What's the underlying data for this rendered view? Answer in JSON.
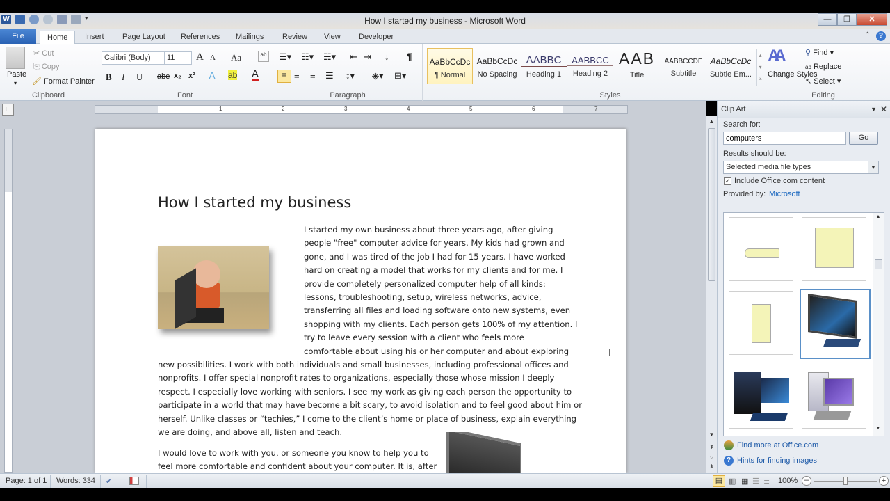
{
  "window": {
    "title": "How I started my business - Microsoft Word",
    "minimize_icon": "minimize-icon",
    "restore_icon": "restore-icon",
    "close_icon": "close-icon"
  },
  "qat": [
    "word-logo-icon",
    "save-icon",
    "undo-icon",
    "redo-icon",
    "print-preview-icon",
    "print-icon",
    "customize-qat-icon"
  ],
  "tabs": [
    "File",
    "Home",
    "Insert",
    "Page Layout",
    "References",
    "Mailings",
    "Review",
    "View",
    "Developer"
  ],
  "ribbon": {
    "clipboard": {
      "label": "Clipboard",
      "paste": "Paste",
      "cut": "Cut",
      "copy": "Copy",
      "format_painter": "Format Painter"
    },
    "font": {
      "label": "Font",
      "font_name": "Calibri (Body)",
      "font_size": "11",
      "grow": "A",
      "shrink": "A",
      "change_case": "Aa",
      "bold": "B",
      "italic": "I",
      "underline": "U",
      "strike": "abe",
      "subscript": "x₂",
      "superscript": "x²"
    },
    "paragraph": {
      "label": "Paragraph",
      "pilcrow": "¶"
    },
    "styles": {
      "label": "Styles",
      "items": [
        {
          "preview": "AaBbCcDc",
          "name": "¶ Normal"
        },
        {
          "preview": "AaBbCcDc",
          "name": "No Spacing"
        },
        {
          "preview": "AABBC",
          "name": "Heading 1"
        },
        {
          "preview": "AABBCC",
          "name": "Heading 2"
        },
        {
          "preview": "AAB",
          "name": "Title"
        },
        {
          "preview": "AABBCCDE",
          "name": "Subtitle"
        },
        {
          "preview": "AaBbCcDc",
          "name": "Subtle Em..."
        }
      ],
      "change_styles": "Change Styles"
    },
    "editing": {
      "label": "Editing",
      "find": "Find",
      "replace": "Replace",
      "select": "Select"
    }
  },
  "ruler": {
    "numbers": [
      "1",
      "2",
      "3",
      "4",
      "5",
      "6",
      "7"
    ]
  },
  "document": {
    "title": "How I started my business",
    "wrapped_lines": [
      "I started my own business about three years ago, after giving",
      "people \"free\" computer advice for years. My kids had grown and",
      "gone, and I was tired of the job I had for 15 years. I have worked",
      "hard on creating a model that works for my clients and for me. I",
      "provide completely personalized computer help of all kinds:",
      "lessons, troubleshooting, setup, wireless networks, advice,",
      "transferring all files and loading software onto new systems, even",
      "shopping with my clients. Each person gets 100% of my attention. I",
      "try to leave every session with a client who feels more",
      "comfortable about using his or her computer and about exploring"
    ],
    "full_lines": [
      "new possibilities. I work with both individuals and small businesses, including professional offices and",
      "nonprofits. I offer special nonprofit rates to organizations, especially those whose mission I deeply",
      "respect. I especially love working with seniors. I see my work as giving each person the opportunity to",
      "participate in a world that may have become a bit scary, to avoid isolation and to feel good about him or",
      "herself. Unlike classes or “techies,” I come to the client’s home or place of business, explain everything",
      "we are doing, and above all, listen and teach."
    ],
    "para2_lines": [
      "I would love to work with you, or someone you know to help you to",
      "feel more comfortable and confident about your computer. It is, after"
    ]
  },
  "clip_art": {
    "title": "Clip Art",
    "search_label": "Search for:",
    "search_value": "computers",
    "go": "Go",
    "results_label": "Results should be:",
    "results_value": "Selected media file types",
    "include_label": "Include Office.com content",
    "include_checked": true,
    "provided_label": "Provided by:",
    "provided_value": "Microsoft",
    "results": [
      "scanner-clipart",
      "form-layout-clipart",
      "tower-clipart",
      "all-in-one-computer-clipart",
      "gaming-pc-clipart",
      "desktop-pc-clipart"
    ],
    "find_more": "Find more at Office.com",
    "hints": "Hints for finding images"
  },
  "status": {
    "page": "Page: 1 of 1",
    "words": "Words: 334",
    "zoom": "100%",
    "zoom_fraction": 0.5
  }
}
